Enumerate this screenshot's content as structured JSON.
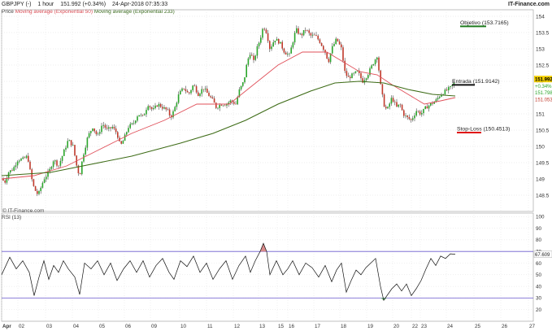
{
  "header": {
    "symbol": "GBPJPY (-)",
    "interval": "1 hour",
    "last": "151.992 (+0.34%)",
    "datetime": "24-Apr-2018 07:35:33",
    "brand": "IT-Finance.com"
  },
  "legend": {
    "price": "Price",
    "ma50": "Moving average (Exponential 50)",
    "ma233": "Moving average (Exponential 233)"
  },
  "copyright": "© IT-Finance.com",
  "colors": {
    "up": "#2aa52a",
    "down": "#c0392b",
    "ma50": "#e0505a",
    "ma233": "#3d6b16",
    "rsi_line": "#111111",
    "rsi_band": "#6a5acd",
    "target_line": "#1d7a1d",
    "stop_line": "#e01010",
    "entry_line": "#111111"
  },
  "chart_data": [
    {
      "type": "candlestick",
      "title": "GBPJPY (-)",
      "y_axis_ticks": [
        148.5,
        149,
        149.5,
        150,
        150.5,
        151,
        151.5,
        152,
        152.5,
        153,
        153.5,
        154
      ],
      "ylim": [
        148.0,
        154.2
      ],
      "x_tick_labels": [
        "Apr",
        "02",
        "03",
        "04",
        "05",
        "06",
        "09",
        "10",
        "11",
        "12",
        "13",
        "15",
        "16",
        "17",
        "18",
        "19",
        "20",
        "22",
        "23",
        "24",
        "25",
        "26",
        "27"
      ],
      "price_path": [
        [
          0,
          149.0
        ],
        [
          4,
          148.9
        ],
        [
          8,
          149.2
        ],
        [
          14,
          149.3
        ],
        [
          20,
          149.6
        ],
        [
          26,
          149.6
        ],
        [
          32,
          149.7
        ],
        [
          36,
          149.1
        ],
        [
          40,
          148.7
        ],
        [
          45,
          148.5
        ],
        [
          52,
          149.0
        ],
        [
          58,
          149.2
        ],
        [
          64,
          149.6
        ],
        [
          70,
          149.4
        ],
        [
          76,
          149.8
        ],
        [
          82,
          150.2
        ],
        [
          88,
          150.0
        ],
        [
          93,
          149.3
        ],
        [
          96,
          149.1
        ],
        [
          100,
          149.7
        ],
        [
          106,
          150.3
        ],
        [
          112,
          150.6
        ],
        [
          118,
          150.3
        ],
        [
          124,
          150.7
        ],
        [
          130,
          150.5
        ],
        [
          136,
          150.6
        ],
        [
          142,
          150.4
        ],
        [
          146,
          150.0
        ],
        [
          150,
          150.2
        ],
        [
          156,
          150.6
        ],
        [
          162,
          150.7
        ],
        [
          168,
          151.0
        ],
        [
          174,
          150.9
        ],
        [
          180,
          151.3
        ],
        [
          186,
          151.1
        ],
        [
          192,
          151.3
        ],
        [
          198,
          151.2
        ],
        [
          204,
          151.1
        ],
        [
          208,
          150.9
        ],
        [
          212,
          151.1
        ],
        [
          218,
          151.6
        ],
        [
          224,
          151.8
        ],
        [
          230,
          151.6
        ],
        [
          236,
          151.9
        ],
        [
          242,
          151.6
        ],
        [
          248,
          151.8
        ],
        [
          254,
          151.6
        ],
        [
          260,
          151.4
        ],
        [
          264,
          151.2
        ],
        [
          270,
          151.3
        ],
        [
          276,
          151.3
        ],
        [
          282,
          151.4
        ],
        [
          288,
          151.3
        ],
        [
          292,
          151.7
        ],
        [
          298,
          152.0
        ],
        [
          302,
          152.6
        ],
        [
          306,
          152.9
        ],
        [
          310,
          152.6
        ],
        [
          314,
          153.0
        ],
        [
          318,
          153.3
        ],
        [
          322,
          153.7
        ],
        [
          326,
          153.5
        ],
        [
          330,
          153.0
        ],
        [
          336,
          153.3
        ],
        [
          342,
          153.2
        ],
        [
          348,
          152.9
        ],
        [
          354,
          152.8
        ],
        [
          358,
          153.2
        ],
        [
          362,
          153.6
        ],
        [
          368,
          153.4
        ],
        [
          374,
          153.6
        ],
        [
          380,
          153.4
        ],
        [
          386,
          153.4
        ],
        [
          392,
          153.2
        ],
        [
          398,
          152.9
        ],
        [
          402,
          152.6
        ],
        [
          406,
          153.0
        ],
        [
          412,
          153.3
        ],
        [
          418,
          153.0
        ],
        [
          422,
          152.3
        ],
        [
          426,
          152.1
        ],
        [
          432,
          152.2
        ],
        [
          438,
          152.3
        ],
        [
          444,
          152.0
        ],
        [
          450,
          152.2
        ],
        [
          456,
          152.5
        ],
        [
          462,
          152.8
        ],
        [
          466,
          151.9
        ],
        [
          470,
          151.3
        ],
        [
          474,
          151.1
        ],
        [
          480,
          151.5
        ],
        [
          486,
          151.2
        ],
        [
          490,
          151.3
        ],
        [
          494,
          151.0
        ],
        [
          498,
          150.9
        ],
        [
          504,
          150.8
        ],
        [
          510,
          151.1
        ],
        [
          516,
          151.0
        ],
        [
          522,
          151.2
        ],
        [
          528,
          151.3
        ],
        [
          534,
          151.4
        ],
        [
          540,
          151.6
        ],
        [
          546,
          151.7
        ],
        [
          552,
          151.8
        ],
        [
          558,
          151.99
        ]
      ],
      "ma50_path": [
        [
          0,
          149.0
        ],
        [
          40,
          149.1
        ],
        [
          80,
          149.4
        ],
        [
          120,
          149.9
        ],
        [
          160,
          150.4
        ],
        [
          200,
          150.8
        ],
        [
          240,
          151.3
        ],
        [
          280,
          151.3
        ],
        [
          310,
          151.9
        ],
        [
          340,
          152.5
        ],
        [
          370,
          152.9
        ],
        [
          400,
          152.9
        ],
        [
          420,
          152.6
        ],
        [
          440,
          152.3
        ],
        [
          462,
          152.2
        ],
        [
          480,
          151.9
        ],
        [
          500,
          151.6
        ],
        [
          520,
          151.3
        ],
        [
          540,
          151.4
        ],
        [
          558,
          151.5
        ]
      ],
      "ma233_path": [
        [
          0,
          149.1
        ],
        [
          60,
          149.2
        ],
        [
          100,
          149.4
        ],
        [
          160,
          149.7
        ],
        [
          220,
          150.1
        ],
        [
          260,
          150.4
        ],
        [
          300,
          150.8
        ],
        [
          340,
          151.3
        ],
        [
          380,
          151.7
        ],
        [
          410,
          151.95
        ],
        [
          440,
          152.0
        ],
        [
          470,
          151.95
        ],
        [
          500,
          151.75
        ],
        [
          530,
          151.6
        ],
        [
          558,
          151.55
        ]
      ],
      "levels": [
        {
          "name": "Objetivo",
          "label": "Objetivo (153.7165)",
          "value": 153.7165
        },
        {
          "name": "Entrada",
          "label": "Entrada (151.9142)",
          "value": 151.9142
        },
        {
          "name": "Stop-Loss",
          "label": "Stop-Loss (150.4513)",
          "value": 150.4513
        }
      ],
      "right_labels": [
        {
          "text": "151.992",
          "value": 152.07,
          "bg": "#f4d000",
          "fg": "#000000"
        },
        {
          "text": "+0.34%",
          "value": 151.86,
          "bg": "#ffffff",
          "fg": "#2aa52a"
        },
        {
          "text": "151.798",
          "value": 151.66,
          "bg": "#ffffff",
          "fg": "#2aa52a"
        },
        {
          "text": "151.053",
          "value": 151.45,
          "bg": "#ffffff",
          "fg": "#c0392b"
        }
      ]
    },
    {
      "type": "line",
      "title": "RSI (13)",
      "y_axis_ticks": [
        20,
        30,
        40,
        50,
        60,
        70,
        80,
        90,
        100
      ],
      "ylim": [
        10,
        103
      ],
      "bands": [
        30,
        70
      ],
      "last_label": "67.609",
      "values": [
        [
          0,
          50
        ],
        [
          10,
          65
        ],
        [
          18,
          55
        ],
        [
          26,
          62
        ],
        [
          34,
          52
        ],
        [
          40,
          32
        ],
        [
          46,
          48
        ],
        [
          52,
          62
        ],
        [
          58,
          46
        ],
        [
          64,
          58
        ],
        [
          70,
          52
        ],
        [
          76,
          62
        ],
        [
          82,
          55
        ],
        [
          90,
          48
        ],
        [
          96,
          33
        ],
        [
          102,
          60
        ],
        [
          110,
          55
        ],
        [
          118,
          62
        ],
        [
          126,
          50
        ],
        [
          134,
          60
        ],
        [
          142,
          45
        ],
        [
          150,
          55
        ],
        [
          158,
          62
        ],
        [
          166,
          52
        ],
        [
          174,
          62
        ],
        [
          182,
          48
        ],
        [
          190,
          58
        ],
        [
          198,
          64
        ],
        [
          206,
          52
        ],
        [
          212,
          46
        ],
        [
          220,
          62
        ],
        [
          228,
          57
        ],
        [
          236,
          66
        ],
        [
          244,
          52
        ],
        [
          252,
          60
        ],
        [
          260,
          46
        ],
        [
          268,
          55
        ],
        [
          276,
          62
        ],
        [
          284,
          46
        ],
        [
          292,
          58
        ],
        [
          300,
          66
        ],
        [
          306,
          52
        ],
        [
          312,
          62
        ],
        [
          318,
          70
        ],
        [
          322,
          77
        ],
        [
          326,
          70
        ],
        [
          330,
          50
        ],
        [
          338,
          62
        ],
        [
          346,
          50
        ],
        [
          352,
          55
        ],
        [
          358,
          62
        ],
        [
          366,
          50
        ],
        [
          374,
          60
        ],
        [
          382,
          56
        ],
        [
          390,
          48
        ],
        [
          398,
          58
        ],
        [
          406,
          44
        ],
        [
          412,
          54
        ],
        [
          418,
          60
        ],
        [
          424,
          35
        ],
        [
          430,
          45
        ],
        [
          436,
          54
        ],
        [
          442,
          50
        ],
        [
          448,
          56
        ],
        [
          454,
          60
        ],
        [
          460,
          64
        ],
        [
          466,
          40
        ],
        [
          470,
          28
        ],
        [
          474,
          32
        ],
        [
          480,
          38
        ],
        [
          486,
          42
        ],
        [
          492,
          36
        ],
        [
          498,
          42
        ],
        [
          504,
          32
        ],
        [
          510,
          38
        ],
        [
          516,
          45
        ],
        [
          522,
          55
        ],
        [
          528,
          64
        ],
        [
          534,
          58
        ],
        [
          540,
          66
        ],
        [
          546,
          64
        ],
        [
          552,
          68
        ],
        [
          558,
          67.6
        ]
      ]
    }
  ]
}
